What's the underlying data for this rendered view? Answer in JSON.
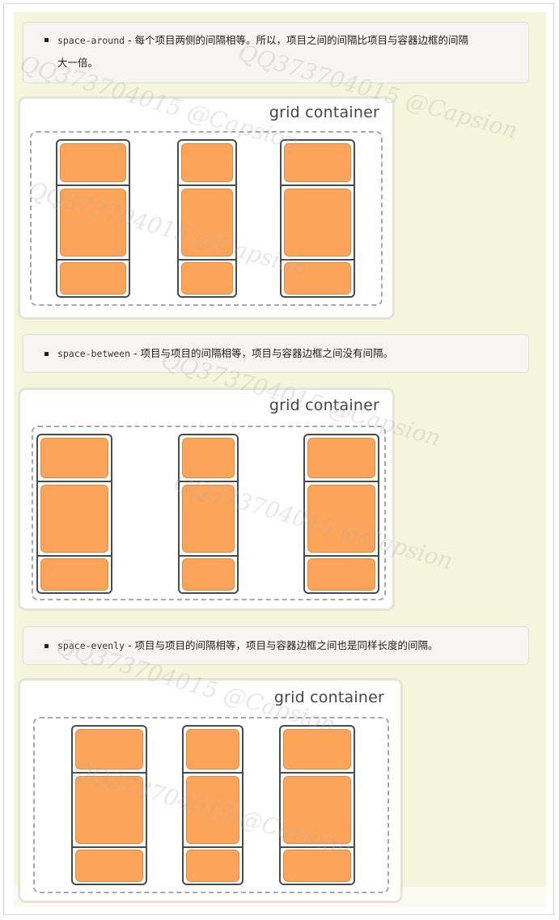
{
  "notes": [
    {
      "code": "space-around",
      "text": " - 每个项目两侧的间隔相等。所以，项目之间的间隔比项目与容器边框的间隔",
      "text2": "大一倍。"
    },
    {
      "code": "space-between",
      "text": " - 项目与项目的间隔相等，项目与容器边框之间没有间隔。"
    },
    {
      "code": "space-evenly",
      "text": " - 项目与项目的间隔相等，项目与容器边框之间也是同样长度的间隔。"
    }
  ],
  "diagrams": [
    {
      "title": "grid container"
    },
    {
      "title": "grid container"
    },
    {
      "title": "grid container"
    }
  ],
  "watermark": "QQ373704015 @Capsion",
  "colors": {
    "item_fill": "#fca55a",
    "item_border": "#e08a3c",
    "page_bg": "#f5f5dc"
  }
}
